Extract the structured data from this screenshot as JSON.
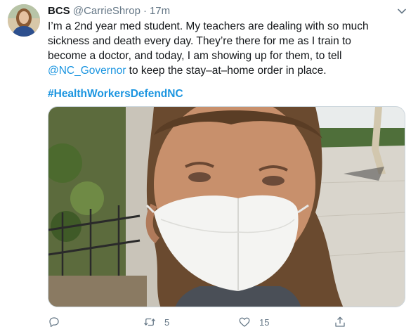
{
  "tweet": {
    "author": {
      "display_name": "BCS",
      "handle": "@CarrieShrop",
      "separator": "·",
      "timestamp": "17m"
    },
    "text": {
      "part1": "I’m a 2nd year med student. My teachers are dealing with so much sickness and death every day. They’re there for me as I train to become a doctor, and today, I am showing up for them, to tell ",
      "mention": "@NC_Governor",
      "part2": " to keep the stay–at–home order in place."
    },
    "hashtag": "#HealthWorkersDefendNC",
    "actions": {
      "reply": {
        "icon": "reply-icon",
        "count": ""
      },
      "retweet": {
        "icon": "retweet-icon",
        "count": "5"
      },
      "like": {
        "icon": "heart-icon",
        "count": "15"
      },
      "share": {
        "icon": "share-icon",
        "count": ""
      }
    },
    "colors": {
      "link": "#1b95e0",
      "secondary_text": "#657786",
      "primary_text": "#14171a"
    }
  }
}
